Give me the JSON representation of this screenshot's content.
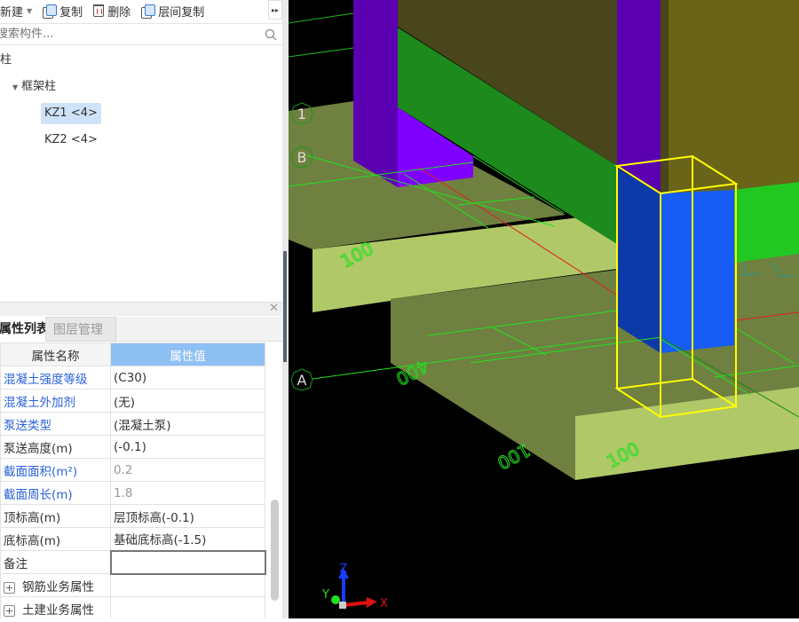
{
  "toolbar": {
    "new_label": "新建",
    "copy_label": "复制",
    "delete_label": "删除",
    "floor_copy_label": "层间复制",
    "more": "▸▸"
  },
  "search": {
    "placeholder": "搜索构件..."
  },
  "tree": {
    "root": "柱",
    "group": "框架柱",
    "items": [
      "KZ1 <4>",
      "KZ2 <4>"
    ],
    "selected": "KZ1 <4>"
  },
  "tabs": {
    "properties": "属性列表",
    "layers": "图层管理"
  },
  "table": {
    "headers": [
      "属性名称",
      "属性值"
    ],
    "rows": [
      {
        "name": "混凝土强度等级",
        "value": "(C30)",
        "name_style": "blue",
        "value_style": ""
      },
      {
        "name": "混凝土外加剂",
        "value": "(无)",
        "name_style": "blue",
        "value_style": ""
      },
      {
        "name": "泵送类型",
        "value": "(混凝土泵)",
        "name_style": "blue",
        "value_style": ""
      },
      {
        "name": "泵送高度(m)",
        "value": "(-0.1)",
        "name_style": "",
        "value_style": ""
      },
      {
        "name": "截面面积(m²)",
        "value": "0.2",
        "name_style": "blue",
        "value_style": "gray"
      },
      {
        "name": "截面周长(m)",
        "value": "1.8",
        "name_style": "blue",
        "value_style": "gray"
      },
      {
        "name": "顶标高(m)",
        "value": "层顶标高(-0.1)",
        "name_style": "",
        "value_style": ""
      },
      {
        "name": "底标高(m)",
        "value": "基础底标高(-1.5)",
        "name_style": "",
        "value_style": ""
      },
      {
        "name": "备注",
        "value": "",
        "name_style": "",
        "value_style": ""
      }
    ],
    "groups": [
      "钢筋业务属性",
      "土建业务属性"
    ]
  },
  "viewport": {
    "axis_labels": [
      "1",
      "B",
      "A"
    ],
    "dimensions": [
      "100",
      "400",
      "100",
      "100"
    ],
    "gizmo": {
      "x": "X",
      "y": "Y",
      "z": "Z"
    }
  },
  "colors": {
    "selected": "#cfe3f8",
    "header_value": "#8fc0f3",
    "link": "#2b63d9",
    "wire": "#ffff00",
    "dim": "#22e022"
  }
}
